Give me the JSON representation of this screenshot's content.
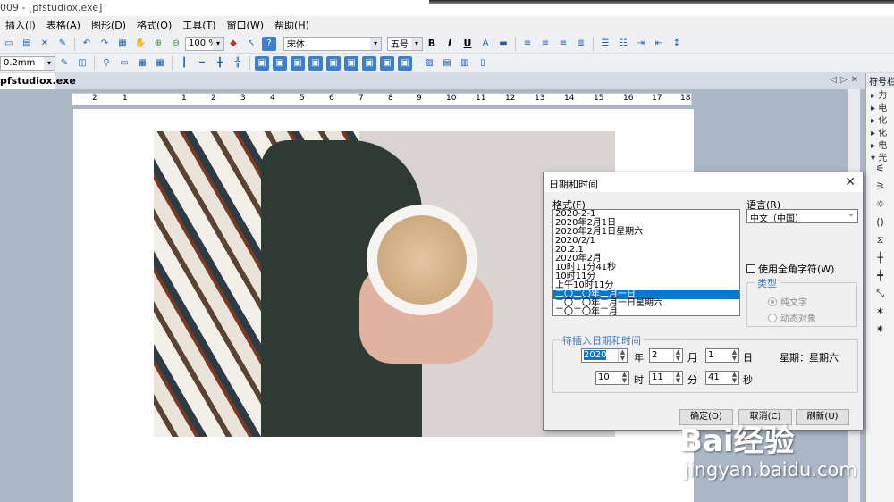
{
  "window": {
    "title": "009 - [pfstudiox.exe]"
  },
  "menu": [
    "插入(I)",
    "表格(A)",
    "图形(D)",
    "格式(O)",
    "工具(T)",
    "窗口(W)",
    "帮助(H)"
  ],
  "toolbar1": {
    "zoom": "100 %",
    "font": "宋体",
    "size": "五号"
  },
  "toolbar2": {
    "line_width": "0.2mm"
  },
  "doc_tab": "pfstudiox.exe",
  "ruler_ticks": [
    "2",
    "1",
    "1",
    "2",
    "3",
    "4",
    "5",
    "6",
    "7",
    "8",
    "9",
    "10",
    "11",
    "12",
    "13",
    "14",
    "15",
    "16",
    "17",
    "18"
  ],
  "side_panel": {
    "title": "符号栏",
    "rows": [
      "力",
      "电",
      "化",
      "化",
      "电",
      "光"
    ]
  },
  "dialog": {
    "title": "日期和时间",
    "format_label": "格式(F)",
    "formats": [
      "2020-2-1",
      "2020年2月1日",
      "2020年2月1日星期六",
      "2020/2/1",
      "20.2.1",
      "2020年2月",
      "10时11分41秒",
      "10时11分",
      "上午10时11分",
      "二〇二〇年二月一日",
      "二〇二〇年二月一日星期六",
      "二〇二〇年二月"
    ],
    "selected_index": 9,
    "language_label": "语言(R)",
    "language_value": "中文（中国）",
    "fullwidth_label": "使用全角字符(W)",
    "type_label": "类型",
    "type_plain": "纯文字",
    "type_dynamic": "动态对象",
    "insert_group_label": "待插入日期和时间",
    "year": "2020",
    "year_unit": "年",
    "month": "2",
    "month_unit": "月",
    "day": "1",
    "day_unit": "日",
    "weekday": "星期：星期六",
    "hour": "10",
    "hour_unit": "时",
    "minute": "11",
    "minute_unit": "分",
    "second": "41",
    "second_unit": "秒",
    "ok": "确定(O)",
    "cancel": "取消(C)",
    "refresh": "刷新(U)"
  },
  "watermark": {
    "brand": "Bai经验",
    "url": "jingyan.baidu.com"
  }
}
